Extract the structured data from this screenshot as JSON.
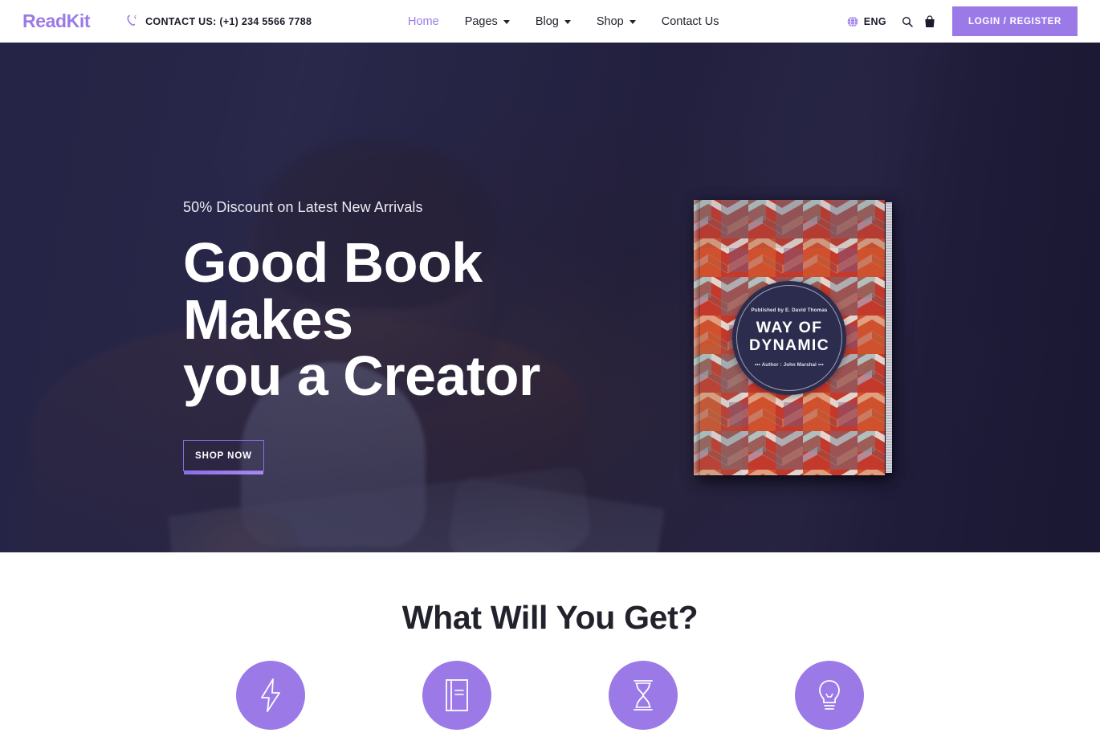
{
  "header": {
    "logo": "ReadKit",
    "contact_label": "CONTACT US:",
    "contact_phone": "(+1) 234 5566 7788",
    "contact_full": "CONTACT US: (+1) 234 5566 7788",
    "phone_icon": "phone-call-icon",
    "nav": [
      {
        "label": "Home",
        "active": true,
        "has_dropdown": false
      },
      {
        "label": "Pages",
        "active": false,
        "has_dropdown": true
      },
      {
        "label": "Blog",
        "active": false,
        "has_dropdown": true
      },
      {
        "label": "Shop",
        "active": false,
        "has_dropdown": true
      },
      {
        "label": "Contact Us",
        "active": false,
        "has_dropdown": false
      }
    ],
    "language": "ENG",
    "globe_icon": "globe-icon",
    "search_icon": "search-icon",
    "cart_icon": "shopping-bag-icon",
    "login_label": "LOGIN / REGISTER"
  },
  "hero": {
    "subtitle": "50% Discount on Latest New Arrivals",
    "title_line1": "Good Book Makes",
    "title_line2": "you a Creator",
    "cta_label": "SHOP NOW",
    "book": {
      "publisher": "Published by E. David Thomas",
      "title_line1": "WAY OF",
      "title_line2": "DYNAMIC",
      "author": "•••  Author : John Marshal  •••"
    }
  },
  "features_section": {
    "title": "What Will You Get?",
    "items": [
      {
        "icon": "lightning-bolt-icon"
      },
      {
        "icon": "book-icon"
      },
      {
        "icon": "hourglass-icon"
      },
      {
        "icon": "lightbulb-icon"
      }
    ]
  },
  "colors": {
    "brand_purple": "#9b7ae8",
    "hero_overlay": "#252446",
    "text_dark": "#22222c",
    "white": "#ffffff"
  }
}
